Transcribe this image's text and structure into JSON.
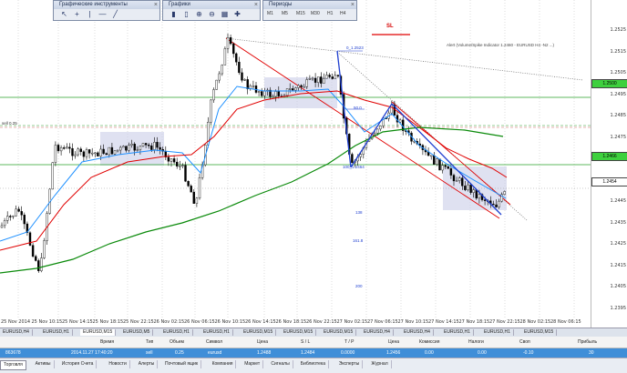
{
  "colors": {
    "ema_fast": "#1e90ff",
    "ema_mid": "#e00000",
    "ema_slow": "#0a8a0a",
    "bull_candle": "#ffffff",
    "bear_candle": "#000000",
    "zone_fill": "#c9cde8",
    "fib_color": "#1f3fd0",
    "selected_row": "#3f8ed8"
  },
  "toolbars": {
    "drawing_title": "Графические инструменты",
    "charts_title": "Графики",
    "periods_title": "Периоды",
    "periods": [
      "M1",
      "M5",
      "M15",
      "M30",
      "H1",
      "H4"
    ],
    "chart_icons": [
      "zoom-in-icon",
      "zoom-out-icon",
      "grid-icon",
      "auto-scroll-icon",
      "add-indicator-icon"
    ],
    "drawing_icons": [
      "cursor-icon",
      "crosshair-icon",
      "vertical-line-icon",
      "horizontal-line-icon",
      "trendline-icon"
    ]
  },
  "chart": {
    "sl_label": "SL",
    "alert_text": "Alert (Volume/Spike Indicator 1.2460 - EURUSD H4 -N2 ...)",
    "hline_label": "sell 0.25",
    "fib_labels": [
      "0_1.2523",
      "50.0",
      "100_1.2464",
      "138",
      "161.8",
      "200"
    ],
    "price_labels": [
      "1.2525",
      "1.2515",
      "1.2505",
      "1.2495",
      "1.2485",
      "1.2475",
      "1.2465",
      "1.2455",
      "1.2445",
      "1.2435",
      "1.2425",
      "1.2415",
      "1.2405",
      "1.2395"
    ],
    "price_tags": [
      "1.2500",
      "1.2466",
      "1.2454"
    ],
    "time_labels": [
      "25 Nov 2014",
      "25 Nov 10:15",
      "25 Nov 14:15",
      "25 Nov 18:15",
      "25 Nov 22:15",
      "26 Nov 02:15",
      "26 Nov 06:15",
      "26 Nov 10:15",
      "26 Nov 14:15",
      "26 Nov 18:15",
      "26 Nov 22:15",
      "27 Nov 02:15",
      "27 Nov 06:15",
      "27 Nov 10:15",
      "27 Nov 14:15",
      "27 Nov 18:15",
      "27 Nov 22:15",
      "28 Nov 02:15",
      "28 Nov 06:15"
    ]
  },
  "chart_tabs": {
    "items": [
      "EURUSD,H4",
      "EURUSD,H1",
      "EURUSD,M15",
      "EURUSD,M5",
      "EURUSD,H1",
      "EURUSD,H1",
      "EURUSD,M15",
      "EURUSD,M15",
      "EURUSD,M15",
      "EURUSD,H4",
      "EURUSD,H4",
      "EURUSD,H1",
      "EURUSD,H1",
      "EURUSD,M15"
    ],
    "active_index": 2
  },
  "terminal": {
    "headers": [
      "Время",
      "Тип",
      "Объем",
      "Символ",
      "Цена",
      "S / L",
      "T / P",
      "Цена",
      "Комиссия",
      "Налоги",
      "Своп",
      "Прибыль"
    ],
    "row": {
      "order": "863678",
      "time": "2014.11.27 17:40:20",
      "type": "sell",
      "volume": "0.25",
      "symbol": "eurusd",
      "open_price": "1.2488",
      "sl": "1.2484",
      "tp": "0.0000",
      "current_price": "1.2456",
      "commission": "0.00",
      "taxes": "0.00",
      "swap": "-0.10",
      "profit": "30"
    },
    "tabs": [
      "Торговля",
      "Активы",
      "История Счета",
      "Новости",
      "Алерты",
      "Почтовый ящик",
      "Компания",
      "Маркет",
      "Сигналы",
      "Библиотека",
      "Эксперты",
      "Журнал"
    ],
    "active_tab": 0
  }
}
